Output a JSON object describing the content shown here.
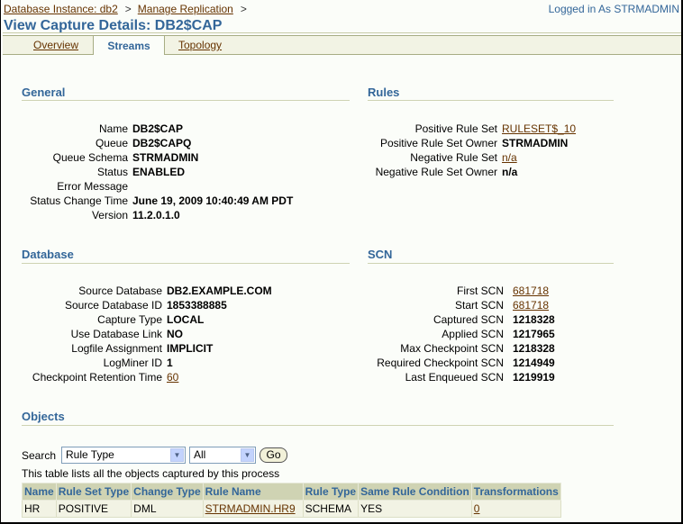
{
  "breadcrumb": [
    {
      "label": "Database Instance: db2"
    },
    {
      "label": "Manage Replication"
    }
  ],
  "breadcrumb_separator": ">",
  "logged_in": "Logged in As STRMADMIN",
  "page_title": "View Capture Details: DB2$CAP",
  "tabs": [
    {
      "label": "Overview",
      "active": false
    },
    {
      "label": "Streams",
      "active": true
    },
    {
      "label": "Topology",
      "active": false
    }
  ],
  "general": {
    "title": "General",
    "rows": [
      {
        "label": "Name",
        "value": "DB2$CAP"
      },
      {
        "label": "Queue",
        "value": "DB2$CAPQ"
      },
      {
        "label": "Queue Schema",
        "value": "STRMADMIN"
      },
      {
        "label": "Status",
        "value": "ENABLED"
      },
      {
        "label": "Error Message",
        "value": ""
      },
      {
        "label": "Status Change Time",
        "value": "June 19, 2009 10:40:49 AM PDT"
      },
      {
        "label": "Version",
        "value": "11.2.0.1.0"
      }
    ]
  },
  "rules": {
    "title": "Rules",
    "rows": [
      {
        "label": "Positive Rule Set",
        "value": "RULESET$_10",
        "link": true
      },
      {
        "label": "Positive Rule Set Owner",
        "value": "STRMADMIN"
      },
      {
        "label": "Negative Rule Set",
        "value": "n/a",
        "link": true
      },
      {
        "label": "Negative Rule Set Owner",
        "value": "n/a"
      }
    ]
  },
  "database": {
    "title": "Database",
    "rows": [
      {
        "label": "Source Database",
        "value": "DB2.EXAMPLE.COM"
      },
      {
        "label": "Source Database ID",
        "value": "1853388885"
      },
      {
        "label": "Capture Type",
        "value": "LOCAL"
      },
      {
        "label": "Use Database Link",
        "value": "NO"
      },
      {
        "label": "Logfile Assignment",
        "value": "IMPLICIT"
      },
      {
        "label": "LogMiner ID",
        "value": "1"
      },
      {
        "label": "Checkpoint Retention Time",
        "value": "60",
        "link": true
      }
    ]
  },
  "scn": {
    "title": "SCN",
    "rows": [
      {
        "label": "First SCN",
        "value": "681718",
        "link": true
      },
      {
        "label": "Start SCN",
        "value": "681718",
        "link": true
      },
      {
        "label": "Captured SCN",
        "value": "1218328"
      },
      {
        "label": "Applied SCN",
        "value": "1217965"
      },
      {
        "label": "Max Checkpoint SCN",
        "value": "1218328"
      },
      {
        "label": "Required Checkpoint SCN",
        "value": "1214949"
      },
      {
        "label": "Last Enqueued SCN",
        "value": "1219919"
      }
    ]
  },
  "objects": {
    "title": "Objects",
    "search_label": "Search",
    "search_field": "Rule Type",
    "search_value": "All",
    "go_label": "Go",
    "description": "This table lists all the objects captured by this process",
    "columns": [
      "Name",
      "Rule Set Type",
      "Change Type",
      "Rule Name",
      "Rule Type",
      "Same Rule Condition",
      "Transformations"
    ],
    "rows": [
      [
        "HR",
        "POSITIVE",
        "DML",
        "STRMADMIN.HR9",
        "SCHEMA",
        "YES",
        "0"
      ]
    ]
  },
  "colors": {
    "accent": "#336699",
    "link": "#663300",
    "header_bg": "#cfd3b3",
    "row_bg": "#f2f3e4"
  }
}
